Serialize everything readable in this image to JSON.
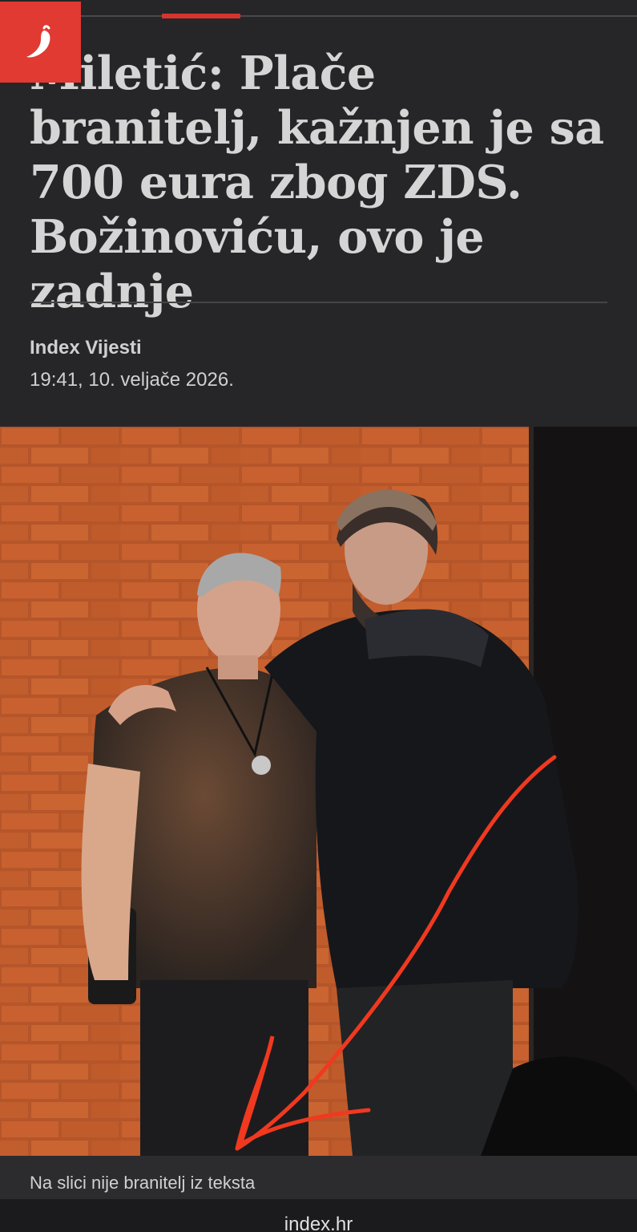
{
  "header": {
    "logo_icon": "chili-pepper-icon",
    "accent_color": "#e03a32"
  },
  "article": {
    "title": "Miletić: Plače branitelj, kažnjen je sa 700 eura zbog ZDS. Božinoviću, ovo je zadnje",
    "author": "Index Vijesti",
    "datetime": "19:41, 10. veljače 2026.",
    "image_caption": "Na slici nije branitelj iz teksta",
    "image_annotation": "red-arrow-drawing"
  },
  "footer": {
    "site": "index.hr"
  }
}
